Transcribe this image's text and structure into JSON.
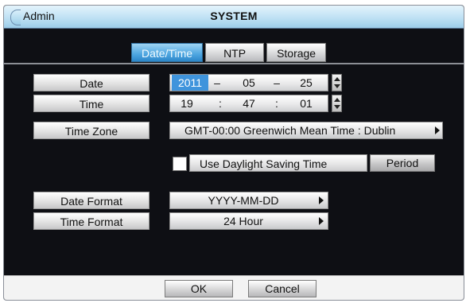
{
  "window": {
    "title_left": "Admin",
    "title_center": "SYSTEM"
  },
  "tabs": [
    {
      "label": "Date/Time",
      "active": true
    },
    {
      "label": "NTP",
      "active": false
    },
    {
      "label": "Storage",
      "active": false
    }
  ],
  "form": {
    "date": {
      "label": "Date",
      "year": "2011",
      "sep1": "–",
      "month": "05",
      "sep2": "–",
      "day": "25"
    },
    "time": {
      "label": "Time",
      "hour": "19",
      "sep1": ":",
      "minute": "47",
      "sep2": ":",
      "second": "01"
    },
    "time_zone": {
      "label": "Time Zone",
      "value": "GMT-00:00 Greenwich Mean Time : Dublin"
    },
    "dst": {
      "label": "Use Daylight Saving Time",
      "checked": false,
      "period_label": "Period"
    },
    "date_format": {
      "label": "Date Format",
      "value": "YYYY-MM-DD"
    },
    "time_format": {
      "label": "Time Format",
      "value": "24 Hour"
    }
  },
  "footer": {
    "ok_label": "OK",
    "cancel_label": "Cancel"
  },
  "colors": {
    "accent": "#3f94dc",
    "panel_bg": "#0e0f14",
    "title_bar": "#bfe1f4"
  }
}
